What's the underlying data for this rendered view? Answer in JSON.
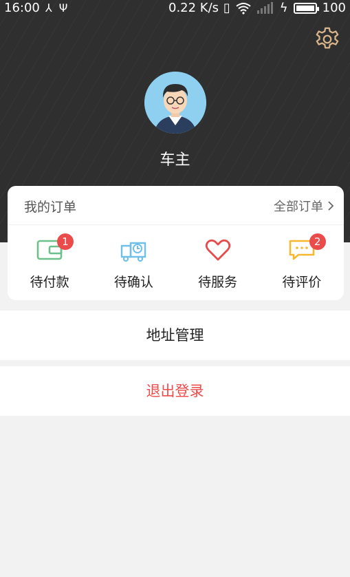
{
  "status_bar": {
    "time": "16:00",
    "net_speed": "0.22 K/s",
    "battery_level": "100",
    "battery_fraction": 1.0
  },
  "profile": {
    "username": "车主"
  },
  "orders": {
    "title": "我的订单",
    "all_orders": "全部订单",
    "items": [
      {
        "label": "待付款",
        "icon": "wallet-icon",
        "badge": "1",
        "color": "#6cc08a"
      },
      {
        "label": "待确认",
        "icon": "truck-clock-icon",
        "badge": "",
        "color": "#6fbfe8"
      },
      {
        "label": "待服务",
        "icon": "heart-icon",
        "badge": "",
        "color": "#e64b4b"
      },
      {
        "label": "待评价",
        "icon": "comment-icon",
        "badge": "2",
        "color": "#f5b82e"
      }
    ]
  },
  "menu": {
    "address": "地址管理",
    "logout": "退出登录"
  },
  "colors": {
    "header_bg": "#2f2f2f",
    "badge": "#ea4b4b",
    "logout": "#ef4a4a",
    "gear": "#d8b58a"
  }
}
